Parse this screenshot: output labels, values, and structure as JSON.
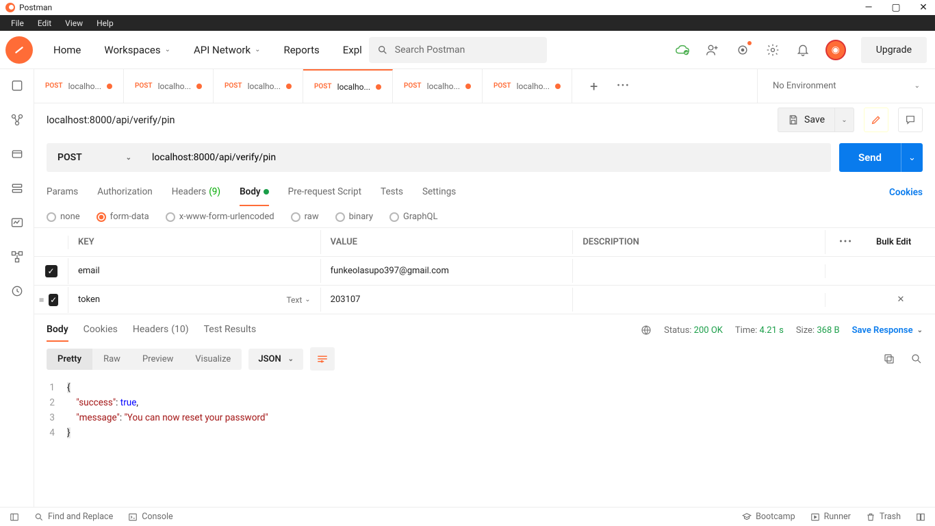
{
  "window": {
    "title": "Postman"
  },
  "menubar": [
    "File",
    "Edit",
    "View",
    "Help"
  ],
  "topbar": {
    "nav": {
      "home": "Home",
      "workspaces": "Workspaces",
      "apinetwork": "API Network",
      "reports": "Reports",
      "explore": "Explo"
    },
    "search_placeholder": "Search Postman",
    "upgrade": "Upgrade"
  },
  "tabs": [
    {
      "method": "POST",
      "title": "localho...",
      "modified": true
    },
    {
      "method": "POST",
      "title": "localho...",
      "modified": true
    },
    {
      "method": "POST",
      "title": "localho...",
      "modified": true
    },
    {
      "method": "POST",
      "title": "localho...",
      "modified": true,
      "active": true
    },
    {
      "method": "POST",
      "title": "localho...",
      "modified": true
    },
    {
      "method": "POST",
      "title": "localho...",
      "modified": true
    }
  ],
  "environment": "No Environment",
  "request": {
    "name": "localhost:8000/api/verify/pin",
    "save": "Save",
    "method": "POST",
    "url": "localhost:8000/api/verify/pin",
    "send": "Send",
    "tabs": {
      "params": "Params",
      "auth": "Authorization",
      "headers": "Headers",
      "headers_count": "(9)",
      "body": "Body",
      "prerequest": "Pre-request Script",
      "tests": "Tests",
      "settings": "Settings",
      "cookies": "Cookies"
    },
    "body_types": {
      "none": "none",
      "formdata": "form-data",
      "xwww": "x-www-form-urlencoded",
      "raw": "raw",
      "binary": "binary",
      "graphql": "GraphQL"
    },
    "kv": {
      "headers": {
        "key": "KEY",
        "value": "VALUE",
        "desc": "DESCRIPTION",
        "bulk": "Bulk Edit"
      },
      "rows": [
        {
          "key": "email",
          "value": "funkeolasupo397@gmail.com",
          "type": ""
        },
        {
          "key": "token",
          "value": "203107",
          "type": "Text"
        }
      ]
    }
  },
  "response": {
    "tabs": {
      "body": "Body",
      "cookies": "Cookies",
      "headers": "Headers",
      "headers_count": "(10)",
      "tests": "Test Results"
    },
    "status_label": "Status:",
    "status_value": "200 OK",
    "time_label": "Time:",
    "time_value": "4.21 s",
    "size_label": "Size:",
    "size_value": "368 B",
    "save": "Save Response",
    "views": {
      "pretty": "Pretty",
      "raw": "Raw",
      "preview": "Preview",
      "visualize": "Visualize"
    },
    "format": "JSON",
    "json": {
      "l1": "{",
      "l2a": "\"success\"",
      "l2b": ": ",
      "l2c": "true",
      "l2d": ",",
      "l3a": "\"message\"",
      "l3b": ": ",
      "l3c": "\"You can now reset your password\"",
      "l4": "}"
    }
  },
  "footer": {
    "find": "Find and Replace",
    "console": "Console",
    "bootcamp": "Bootcamp",
    "runner": "Runner",
    "trash": "Trash"
  }
}
